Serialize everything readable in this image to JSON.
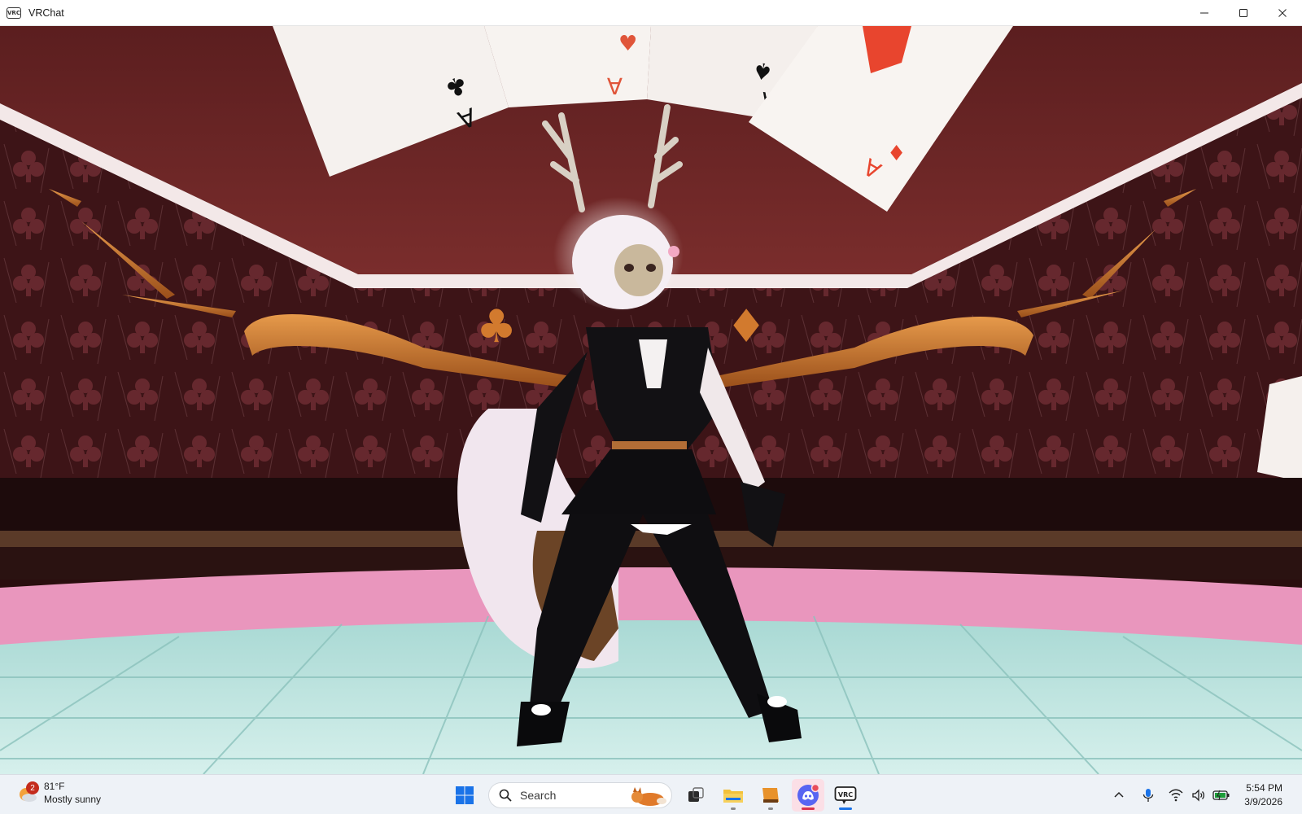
{
  "window": {
    "app_icon": "VRC",
    "title": "VRChat",
    "controls": [
      "minimize-icon",
      "maximize-icon",
      "close-icon"
    ]
  },
  "scene": {
    "description_icons": [
      "playing-card-ace-clubs",
      "playing-card-ace-hearts",
      "playing-card-ace-spades",
      "playing-card-ace-diamonds",
      "club-ornament",
      "diamond-ornament",
      "avatar-character"
    ],
    "card_glyph": "A",
    "colors": {
      "wall": "#4a1a1e",
      "trim": "#f2e6e6",
      "gold": "#c8782a",
      "floor": "#b9e3df",
      "floor_rim": "#e48ab2",
      "avatar_outfit": "#121114"
    }
  },
  "taskbar": {
    "weather": {
      "badge": "2",
      "temperature": "81°F",
      "condition": "Mostly sunny"
    },
    "search_placeholder": "Search",
    "apps": [
      "windows-start-icon",
      "search-icon",
      "task-view-icon",
      "file-explorer-icon",
      "folder-icon",
      "discord-icon",
      "vrchat-icon"
    ],
    "tray": [
      "chevron-up-icon",
      "microphone-icon",
      "wifi-icon",
      "speaker-icon",
      "battery-icon"
    ],
    "time": "5:54 PM",
    "date": "3/9/2026"
  }
}
